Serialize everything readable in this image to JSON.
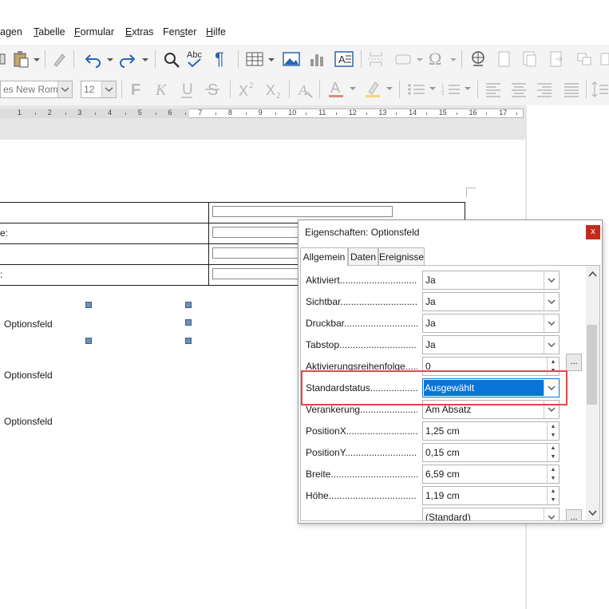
{
  "menubar": {
    "items": [
      {
        "pre": "",
        "acc": "",
        "post": "agen"
      },
      {
        "pre": "",
        "acc": "T",
        "post": "abelle"
      },
      {
        "pre": "",
        "acc": "F",
        "post": "ormular"
      },
      {
        "pre": "",
        "acc": "E",
        "post": "xtras"
      },
      {
        "pre": "Fen",
        "acc": "s",
        "post": "ter"
      },
      {
        "pre": "",
        "acc": "H",
        "post": "ilfe"
      }
    ]
  },
  "toolbar": {
    "font_name": "es New Roman",
    "font_size": "12"
  },
  "ruler": {
    "numbers": [
      "1",
      "2",
      "3",
      "4",
      "5",
      "6",
      "7",
      "8",
      "9",
      "10",
      "11",
      "12",
      "13",
      "14",
      "15",
      "16",
      "17"
    ]
  },
  "document": {
    "row_fragments": [
      "e:",
      ":"
    ],
    "options": [
      "Optionsfeld",
      "Optionsfeld",
      "Optionsfeld"
    ]
  },
  "dialog": {
    "title": "Eigenschaften: Optionsfeld",
    "close": "x",
    "tabs": [
      "Allgemein",
      "Daten",
      "Ereignisse"
    ],
    "props": [
      {
        "label": "Aktiviert....................................................",
        "value": "Ja"
      },
      {
        "label": "Sichtbar....................................................",
        "value": "Ja"
      },
      {
        "label": "Druckbar....................................................",
        "value": "Ja"
      },
      {
        "label": "Tabstop....................................................",
        "value": "Ja"
      },
      {
        "label": "Aktivierungsreihenfolge...........................",
        "value": "0"
      },
      {
        "label": "Standardstatus....................................",
        "value": "Ausgewählt"
      },
      {
        "label": "Verankerung....................................",
        "value": "Am Absatz"
      },
      {
        "label": "PositionX....................................................",
        "value": "1,25 cm"
      },
      {
        "label": "PositionY....................................................",
        "value": "0,15 cm"
      },
      {
        "label": "Breite....................................................",
        "value": "6,59 cm"
      },
      {
        "label": "Höhe....................................................",
        "value": "1,19 cm"
      },
      {
        "label": "",
        "value": "(Standard)"
      }
    ],
    "more_button": "..."
  },
  "colors": {
    "selection": "#0a74d8",
    "highlight": "#e04848",
    "close": "#c42b1c"
  }
}
